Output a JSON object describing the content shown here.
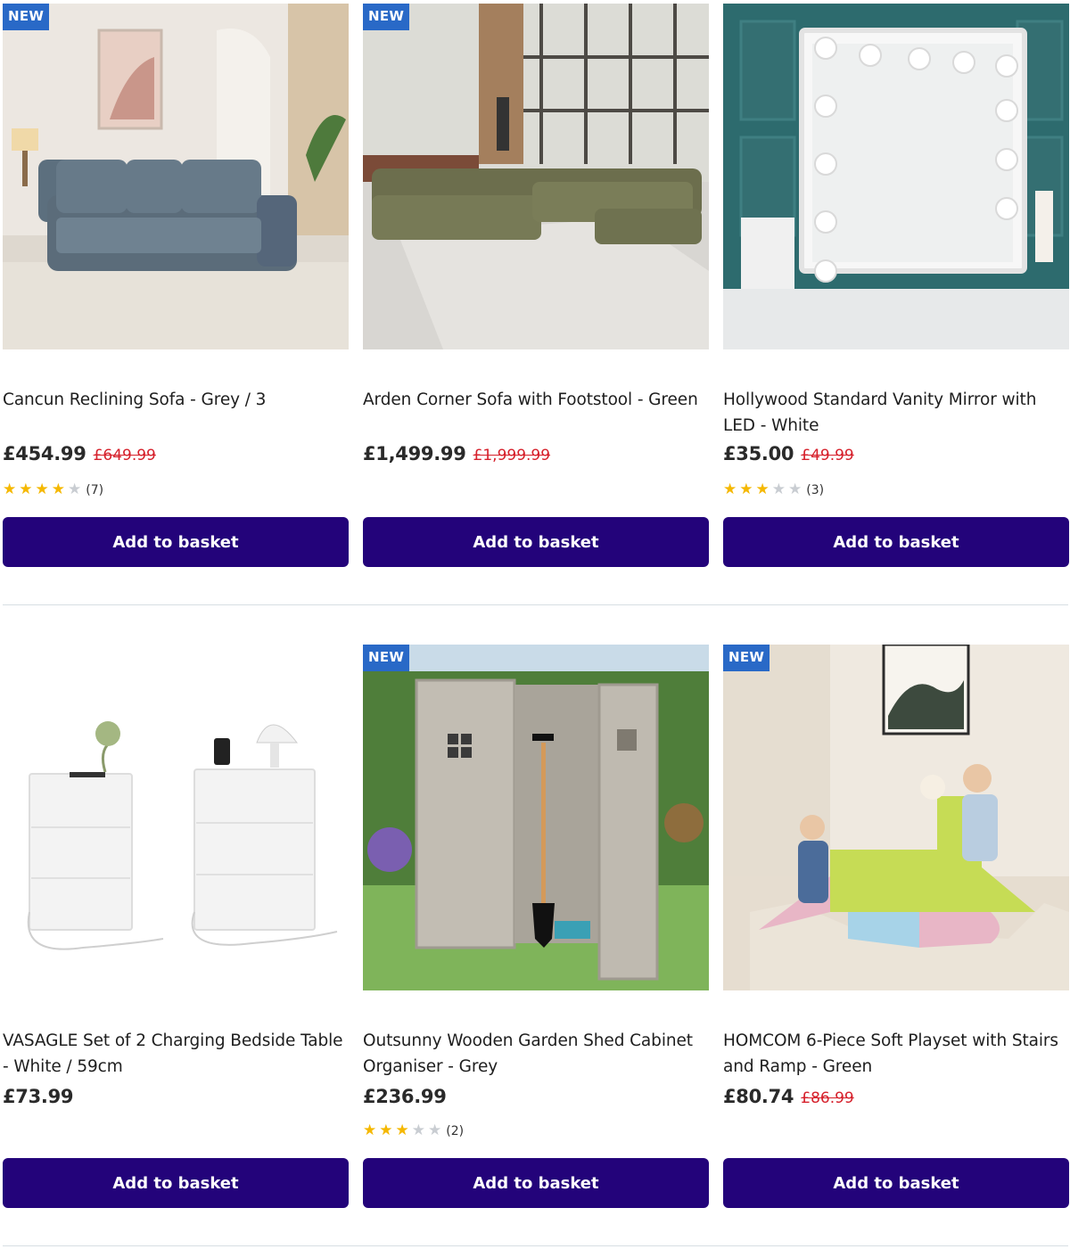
{
  "badge_text": "NEW",
  "colors": {
    "button_bg": "#23037a",
    "badge_bg": "#2969c7",
    "was_price": "#d6202b",
    "star_on": "#f5b800",
    "star_off": "#c9cdd2"
  },
  "products": [
    {
      "title": "Cancun Reclining Sofa - Grey / 3",
      "price": "£454.99",
      "was_price": "£649.99",
      "new": true,
      "rating": 4,
      "rating_count": "(7)",
      "button_label": "Add to basket",
      "image": "grey-recliner-sofa"
    },
    {
      "title": "Arden Corner Sofa with Footstool - Green",
      "price": "£1,499.99",
      "was_price": "£1,999.99",
      "new": true,
      "rating": null,
      "rating_count": null,
      "button_label": "Add to basket",
      "image": "green-corner-sofa"
    },
    {
      "title": "Hollywood Standard Vanity Mirror with LED - White",
      "price": "£35.00",
      "was_price": "£49.99",
      "new": false,
      "rating": 3,
      "rating_count": "(3)",
      "button_label": "Add to basket",
      "image": "led-vanity-mirror"
    },
    {
      "title": "VASAGLE Set of 2 Charging Bedside Table - White / 59cm",
      "price": "£73.99",
      "was_price": null,
      "new": false,
      "rating": null,
      "rating_count": null,
      "button_label": "Add to basket",
      "image": "white-bedside-tables"
    },
    {
      "title": "Outsunny Wooden Garden Shed Cabinet Organiser - Grey",
      "price": "£236.99",
      "was_price": null,
      "new": true,
      "rating": 3,
      "rating_count": "(2)",
      "button_label": "Add to basket",
      "image": "wooden-garden-shed"
    },
    {
      "title": "HOMCOM 6-Piece Soft Playset with Stairs and Ramp - Green",
      "price": "£80.74",
      "was_price": "£86.99",
      "new": true,
      "rating": null,
      "rating_count": null,
      "button_label": "Add to basket",
      "image": "soft-playset"
    }
  ]
}
